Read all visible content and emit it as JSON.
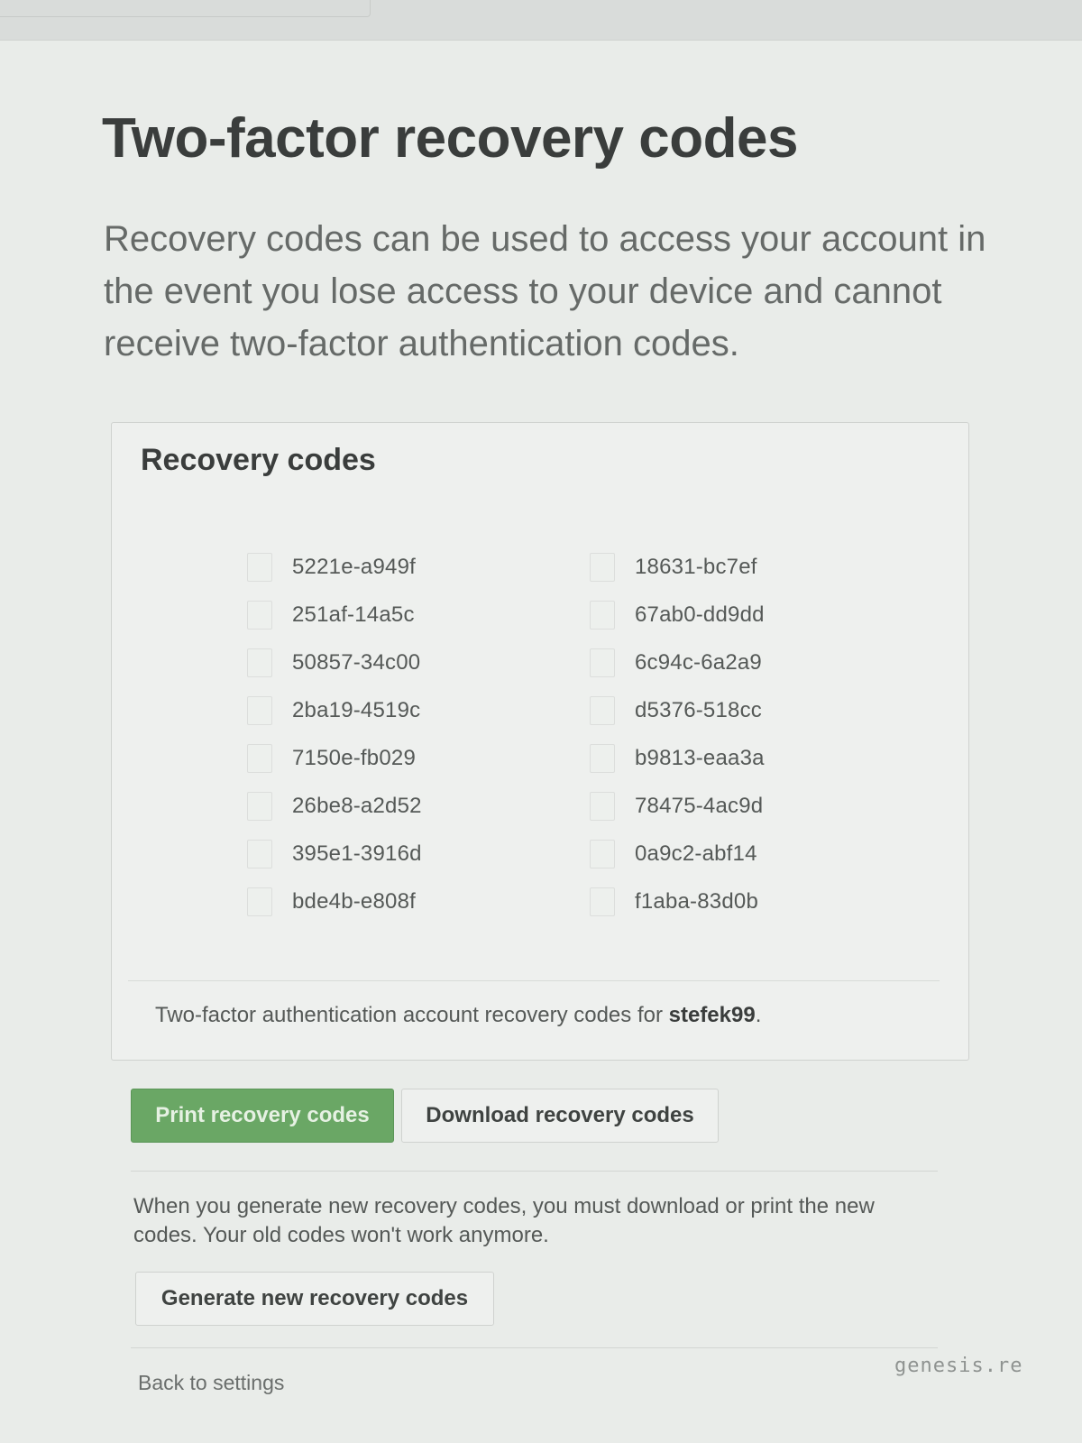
{
  "page": {
    "title": "Two-factor recovery codes",
    "intro": "Recovery codes can be used to access your account in the event you lose access to your device and cannot receive two-factor authentication codes."
  },
  "codes_box": {
    "title": "Recovery codes",
    "codes_left": [
      "5221e-a949f",
      "251af-14a5c",
      "50857-34c00",
      "2ba19-4519c",
      "7150e-fb029",
      "26be8-a2d52",
      "395e1-3916d",
      "bde4b-e808f"
    ],
    "codes_right": [
      "18631-bc7ef",
      "67ab0-dd9dd",
      "6c94c-6a2a9",
      "d5376-518cc",
      "b9813-eaa3a",
      "78475-4ac9d",
      "0a9c2-abf14",
      "f1aba-83d0b"
    ],
    "footer_prefix": "Two-factor authentication account recovery codes for ",
    "username": "stefek99",
    "footer_suffix": "."
  },
  "actions": {
    "print_label": "Print recovery codes",
    "download_label": "Download recovery codes"
  },
  "regenerate": {
    "warning": "When you generate new recovery codes, you must download or print the new codes. Your old codes won't work anymore.",
    "button_label": "Generate new recovery codes"
  },
  "navigation": {
    "back_label": "Back to settings"
  },
  "watermark": "genesis.re",
  "colors": {
    "primary_button": "#6aa765",
    "background": "#e9ece9",
    "title_text": "#3a3d3c"
  }
}
